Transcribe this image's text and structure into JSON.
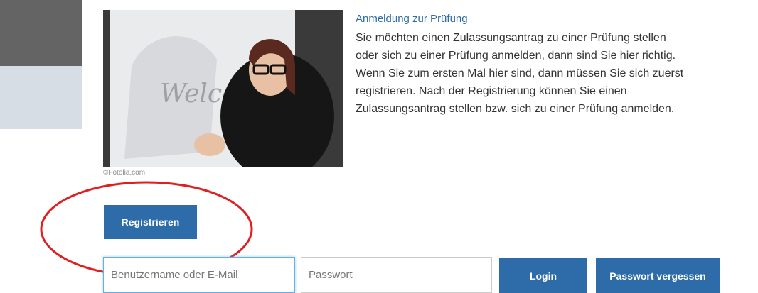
{
  "photo": {
    "credit": "©Fotolia.com",
    "board_text": "Welcome"
  },
  "info": {
    "title": "Anmeldung zur Prüfung",
    "lines": [
      "Sie möchten einen Zulassungsantrag zu einer Prüfung stellen",
      "oder sich zu einer Prüfung anmelden, dann sind Sie hier richtig.",
      "Wenn Sie zum ersten Mal hier sind, dann müssen Sie sich zuerst",
      "registrieren. Nach der Registrierung können Sie einen",
      "Zulassungsantrag stellen bzw. sich zu einer Prüfung anmelden."
    ]
  },
  "buttons": {
    "register": "Registrieren",
    "login": "Login",
    "forgot_password": "Passwort vergessen"
  },
  "form": {
    "username_placeholder": "Benutzername oder E-Mail",
    "username_value": "",
    "password_placeholder": "Passwort",
    "password_value": ""
  },
  "colors": {
    "primary": "#2d6ca8",
    "annotation": "#e02020",
    "sidebar_dark": "#646464",
    "sidebar_light": "#d7dde4"
  }
}
